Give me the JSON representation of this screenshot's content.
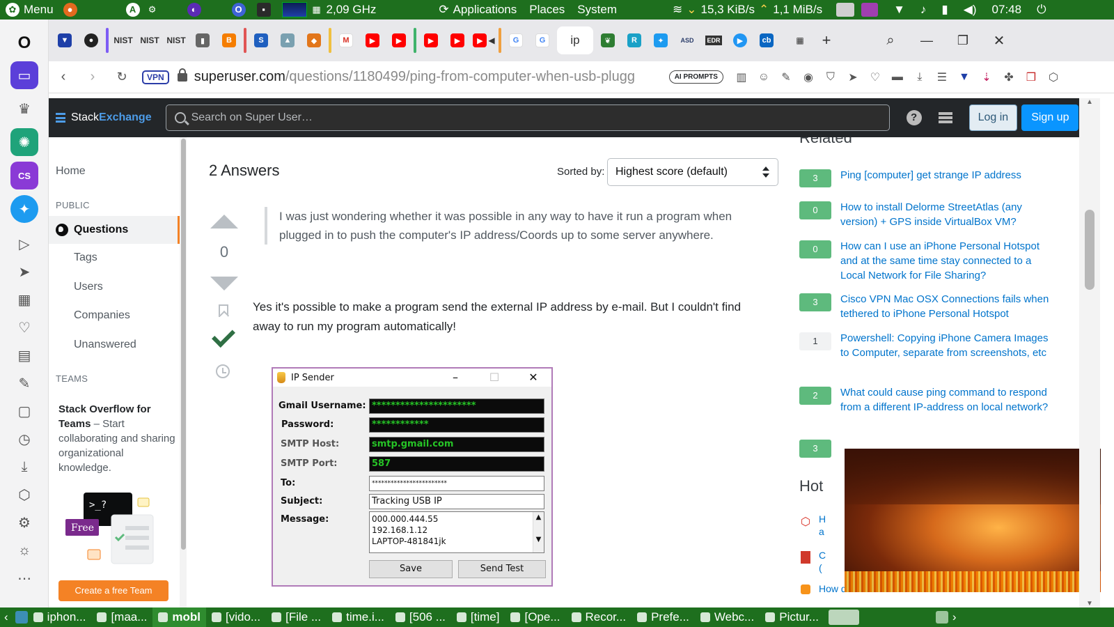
{
  "os_panel": {
    "menu_label": "Menu",
    "cpu_freq": "2,09 GHz",
    "applications": "Applications",
    "places": "Places",
    "system": "System",
    "net_down": "15,3 KiB/s",
    "net_up": "1,1 MiB/s",
    "clock": "07:48"
  },
  "browser": {
    "url_host": "superuser.com",
    "url_path": "/questions/1180499/ping-from-computer-when-usb-plugg",
    "vpn_label": "VPN",
    "ai_prompts": "AI PROMPTS",
    "tabs": [
      {
        "label": "",
        "icon": "shield-icon",
        "color": "#1e3fa8"
      },
      {
        "label": "",
        "icon": "github-icon",
        "color": "#222222"
      },
      {
        "label": "NIST",
        "icon": "nist-icon",
        "color": "#333333"
      },
      {
        "label": "NIST",
        "icon": "nist-icon",
        "color": "#333333"
      },
      {
        "label": "NIST",
        "icon": "nist-icon",
        "color": "#333333"
      },
      {
        "label": "",
        "icon": "doc-icon",
        "color": "#666666"
      },
      {
        "label": "",
        "icon": "blogger-icon",
        "color": "#f57d00"
      },
      {
        "label": "",
        "icon": "s-icon",
        "color": "#1f5fbf"
      },
      {
        "label": "",
        "icon": "mountain-icon",
        "color": "#7aa0b0"
      },
      {
        "label": "",
        "icon": "fox-icon",
        "color": "#e2761b"
      },
      {
        "label": "",
        "icon": "gmail-icon",
        "color": "#d93025"
      },
      {
        "label": "",
        "icon": "youtube-icon",
        "color": "#ff0000"
      },
      {
        "label": "",
        "icon": "youtube-icon",
        "color": "#ff0000"
      },
      {
        "label": "",
        "icon": "youtube-icon",
        "color": "#ff0000"
      },
      {
        "label": "",
        "icon": "youtube-icon",
        "color": "#ff0000"
      },
      {
        "label": "",
        "icon": "youtube-icon",
        "color": "#ff0000"
      },
      {
        "label": "",
        "icon": "google-icon",
        "color": "#4285f4"
      },
      {
        "label": "",
        "icon": "google-icon",
        "color": "#4285f4"
      },
      {
        "label": "ip",
        "icon": "ip-icon",
        "color": "#222222"
      },
      {
        "label": "",
        "icon": "leaf-icon",
        "color": "#2e7d32"
      },
      {
        "label": "",
        "icon": "r-icon",
        "color": "#1aa1c7"
      },
      {
        "label": "",
        "icon": "twitter-icon",
        "color": "#1d9bf0"
      },
      {
        "label": "ASD",
        "icon": "asd-icon",
        "color": "#2c3e6b"
      },
      {
        "label": "EDR",
        "icon": "edr-icon",
        "color": "#333333"
      },
      {
        "label": "",
        "icon": "play-icon",
        "color": "#2196f3"
      },
      {
        "label": "cb",
        "icon": "cb-icon",
        "color": "#0a66c2"
      }
    ]
  },
  "se_header": {
    "brand_a": "Stack",
    "brand_b": "Exchange",
    "search_placeholder": "Search on Super User…",
    "help": "?",
    "login": "Log in",
    "signup": "Sign up"
  },
  "leftnav": {
    "home": "Home",
    "public": "PUBLIC",
    "questions": "Questions",
    "tags": "Tags",
    "users": "Users",
    "companies": "Companies",
    "unanswered": "Unanswered",
    "teams": "TEAMS",
    "teams_title": "Stack Overflow for Teams",
    "teams_desc": " – Start collaborating and sharing organizational knowledge.",
    "free_badge": "Free",
    "prompt_glyph": ">_?",
    "create_team": "Create a free Team"
  },
  "main": {
    "answers_heading": "2 Answers",
    "sorted_by": "Sorted by:",
    "sort_value": "Highest score (default)",
    "vote_count": "0",
    "quote": "I was just wondering whether it was possible in any way to have it run a program when plugged in to push the computer's IP address/Coords up to some server anywhere.",
    "answer": "Yes it's possible to make a program send the external IP address by e-mail. But I couldn't find away to run my program automatically!"
  },
  "dialog": {
    "title": "IP Sender",
    "labels": {
      "gmail_user": "Gmail Username:",
      "password": "Password:",
      "smtp_host": "SMTP Host:",
      "smtp_port": "SMTP Port:",
      "to": "To:",
      "subject": "Subject:",
      "message": "Message:"
    },
    "values": {
      "gmail_user": "**********************",
      "password": "************",
      "smtp_host": "smtp.gmail.com",
      "smtp_port": "587",
      "to": "************************",
      "subject": "Tracking USB IP"
    },
    "message_lines": [
      "000.000.444.55",
      "192.168.1.12",
      "LAPTOP-481841jk"
    ],
    "save": "Save",
    "send_test": "Send Test"
  },
  "sidebar": {
    "related_heading": "Related",
    "related": [
      {
        "score": "3",
        "accepted": true,
        "title": "Ping [computer] get strange IP address"
      },
      {
        "score": "0",
        "accepted": true,
        "title": "How to install Delorme StreetAtlas (any version) + GPS inside VirtualBox VM?"
      },
      {
        "score": "0",
        "accepted": true,
        "title": "How can I use an iPhone Personal Hotspot and at the same time stay connected to a Local Network for File Sharing?"
      },
      {
        "score": "3",
        "accepted": true,
        "title": "Cisco VPN Mac OSX Connections fails when tethered to iPhone Personal Hotspot"
      },
      {
        "score": "1",
        "accepted": false,
        "title": "Powershell: Copying iPhone Camera Images to Computer, separate from screenshots, etc"
      },
      {
        "score": "2",
        "accepted": true,
        "title": "What could cause ping command to respond from a different IP-address on local network?"
      },
      {
        "score": "3",
        "accepted": true,
        "title": ""
      }
    ],
    "hot_heading": "Hot",
    "hot_partial": [
      "H",
      "a",
      "C",
      "("
    ],
    "hot_bottom": "How does it contribute to the Bitcoin network when"
  },
  "taskbar": {
    "items": [
      {
        "label": "iphon..."
      },
      {
        "label": "[maa..."
      },
      {
        "label": "mobl",
        "active": true
      },
      {
        "label": "[vido..."
      },
      {
        "label": "[File ..."
      },
      {
        "label": "time.i..."
      },
      {
        "label": "[506 ..."
      },
      {
        "label": "[time]"
      },
      {
        "label": "[Ope..."
      },
      {
        "label": "Recor..."
      },
      {
        "label": "Prefe..."
      },
      {
        "label": "Webc..."
      },
      {
        "label": "Pictur..."
      }
    ]
  }
}
